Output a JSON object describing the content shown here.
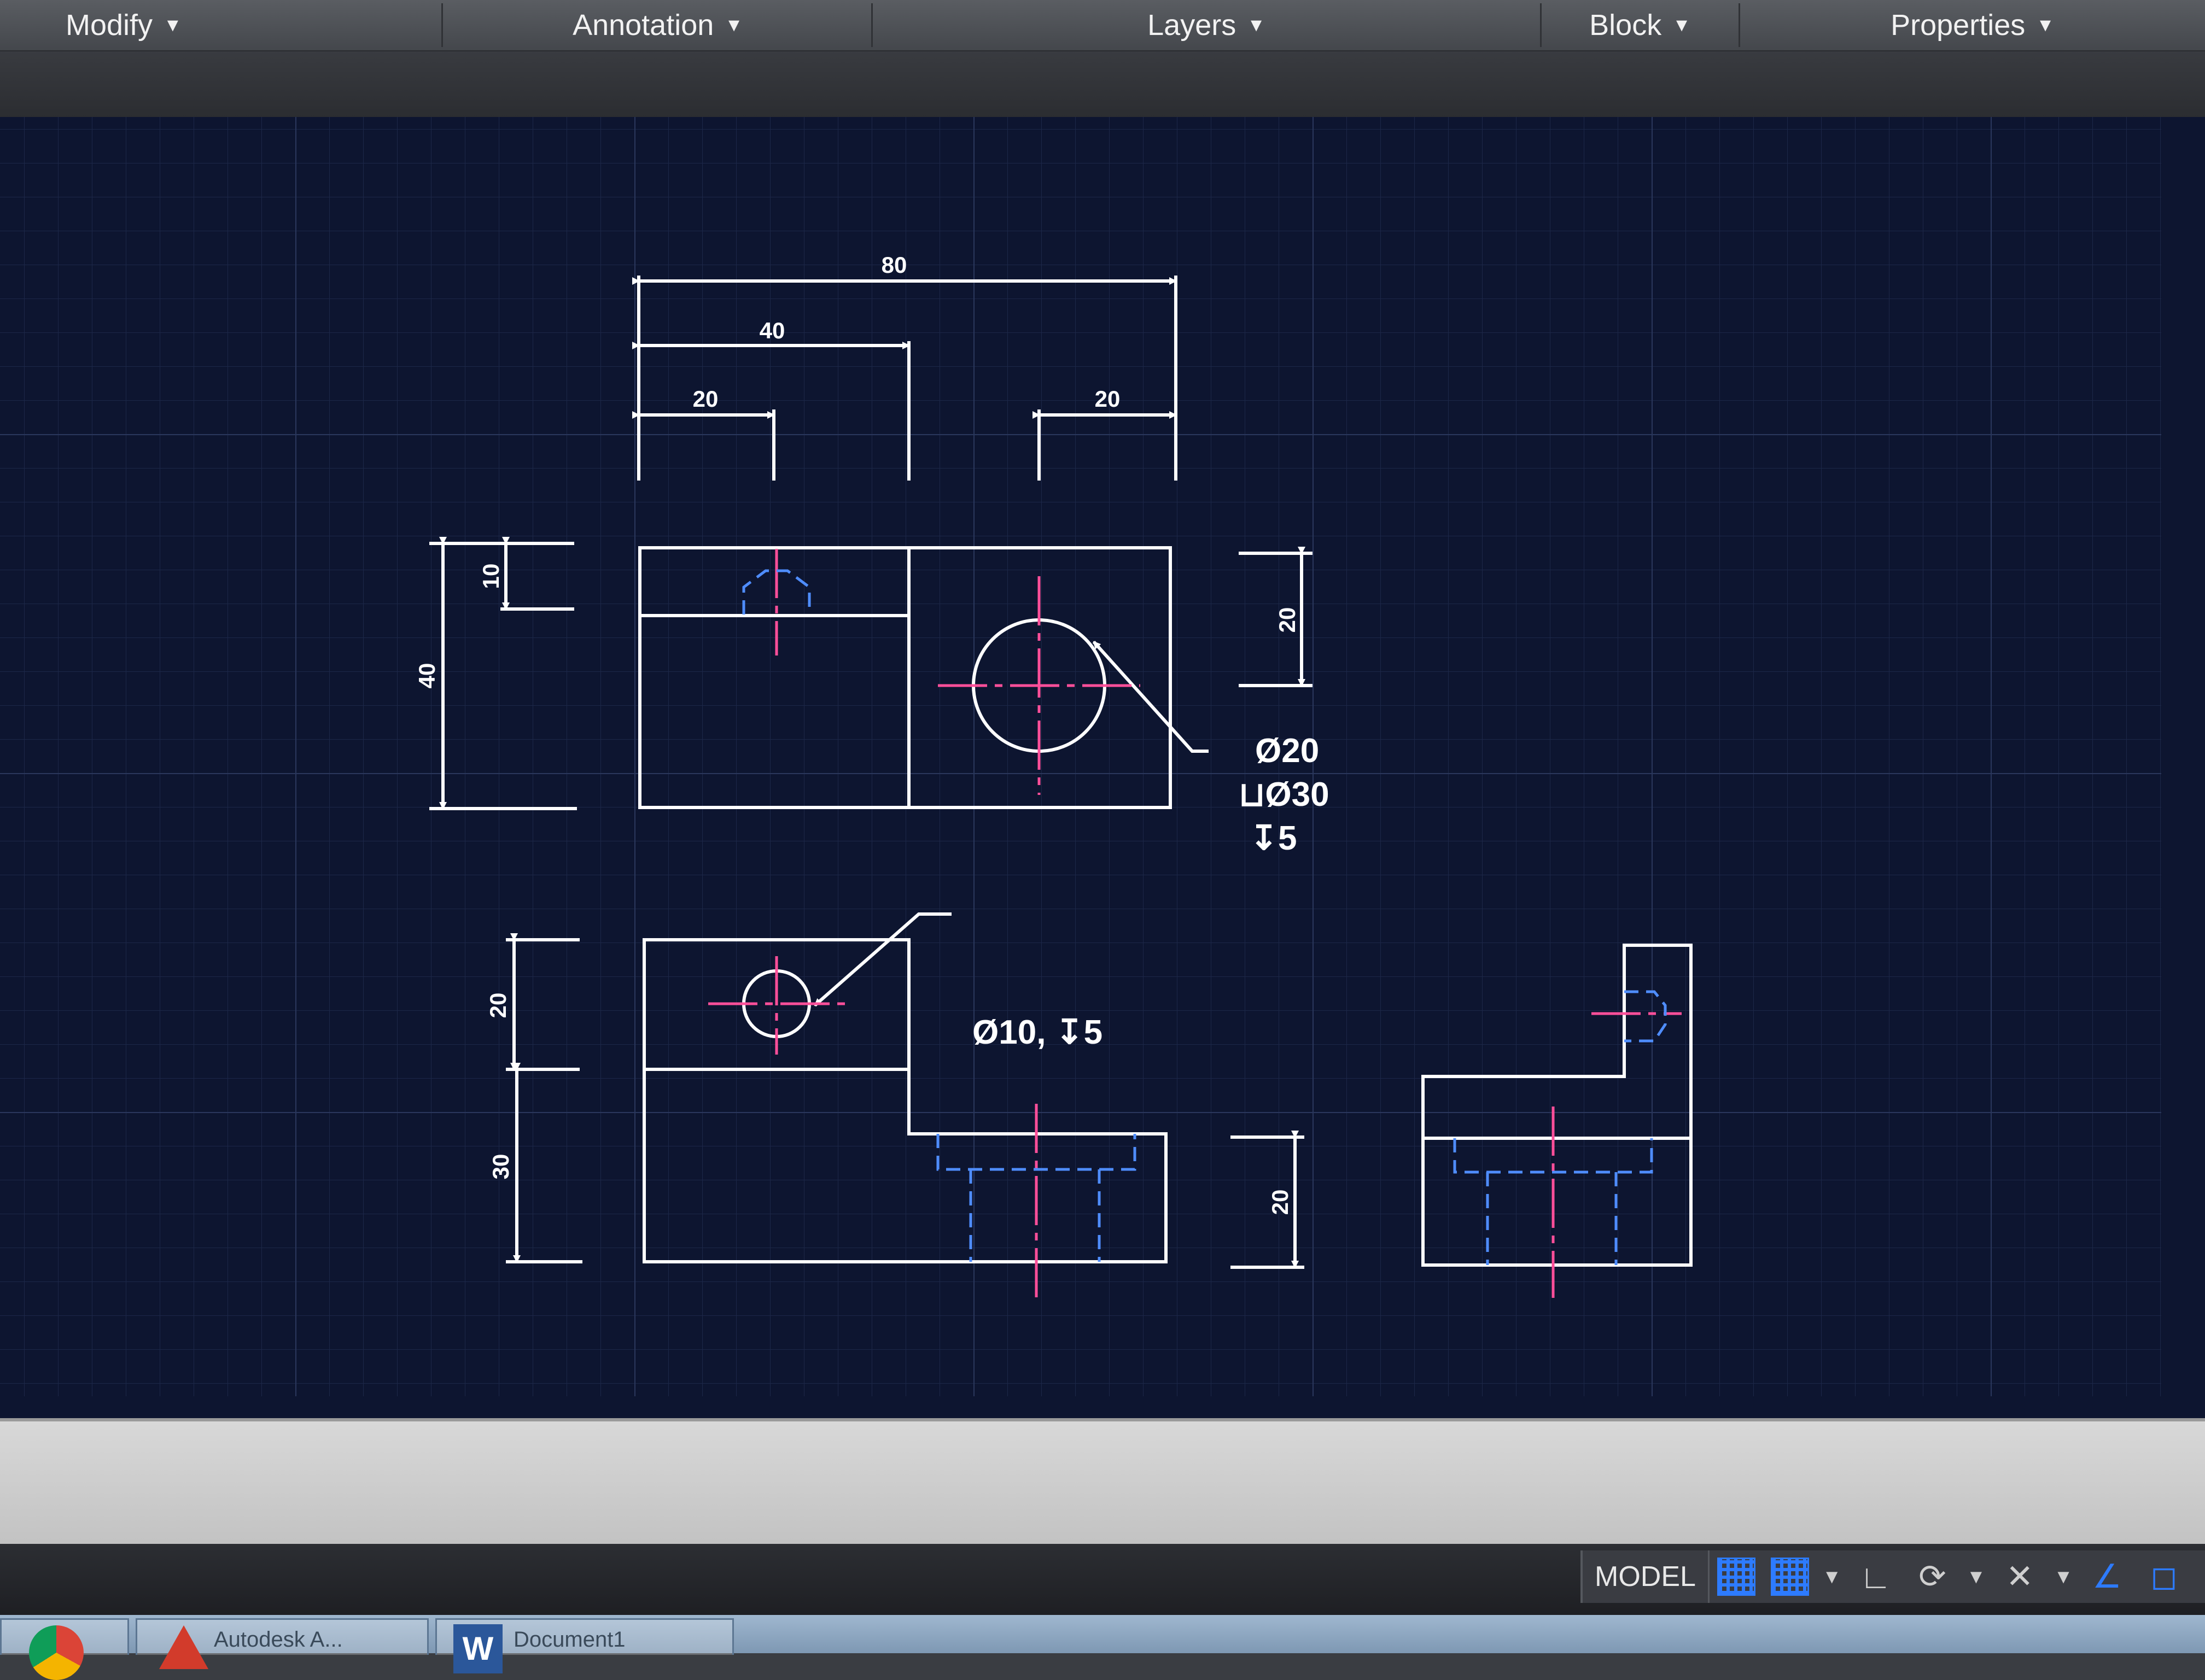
{
  "ribbon": {
    "panels": [
      {
        "label": "Modify"
      },
      {
        "label": "Annotation"
      },
      {
        "label": "Layers"
      },
      {
        "label": "Block"
      },
      {
        "label": "Properties"
      }
    ]
  },
  "drawing": {
    "dimensions": {
      "top_overall": "80",
      "top_mid": "40",
      "top_left_small": "20",
      "top_right_small": "20",
      "front_left_total": "40",
      "front_left_step": "10",
      "front_right": "20",
      "side_left_upper": "20",
      "side_left_lower": "30",
      "side_right": "20"
    },
    "callouts": {
      "hole_large": [
        "Ø20",
        "⊔Ø30",
        "↧5"
      ],
      "hole_small": "Ø10, ↧5"
    },
    "colors": {
      "background": "#0d1530",
      "grid_minor": "#1c2748",
      "grid_major": "#2a375c",
      "object_lines": "#ffffff",
      "center_lines": "#ff4f9a",
      "hidden_lines": "#4f8dff"
    }
  },
  "status_bar": {
    "model_label": "MODEL",
    "icons": [
      "grid-icon",
      "snap-icon",
      "ortho-icon",
      "polar-icon",
      "osnap-icon",
      "workspace-icon"
    ]
  },
  "taskbar": {
    "apps": [
      {
        "icon": "chrome-icon"
      },
      {
        "icon": "autocad-icon",
        "label": "Autodesk A..."
      },
      {
        "icon": "word-icon",
        "label": "Document1"
      }
    ]
  }
}
